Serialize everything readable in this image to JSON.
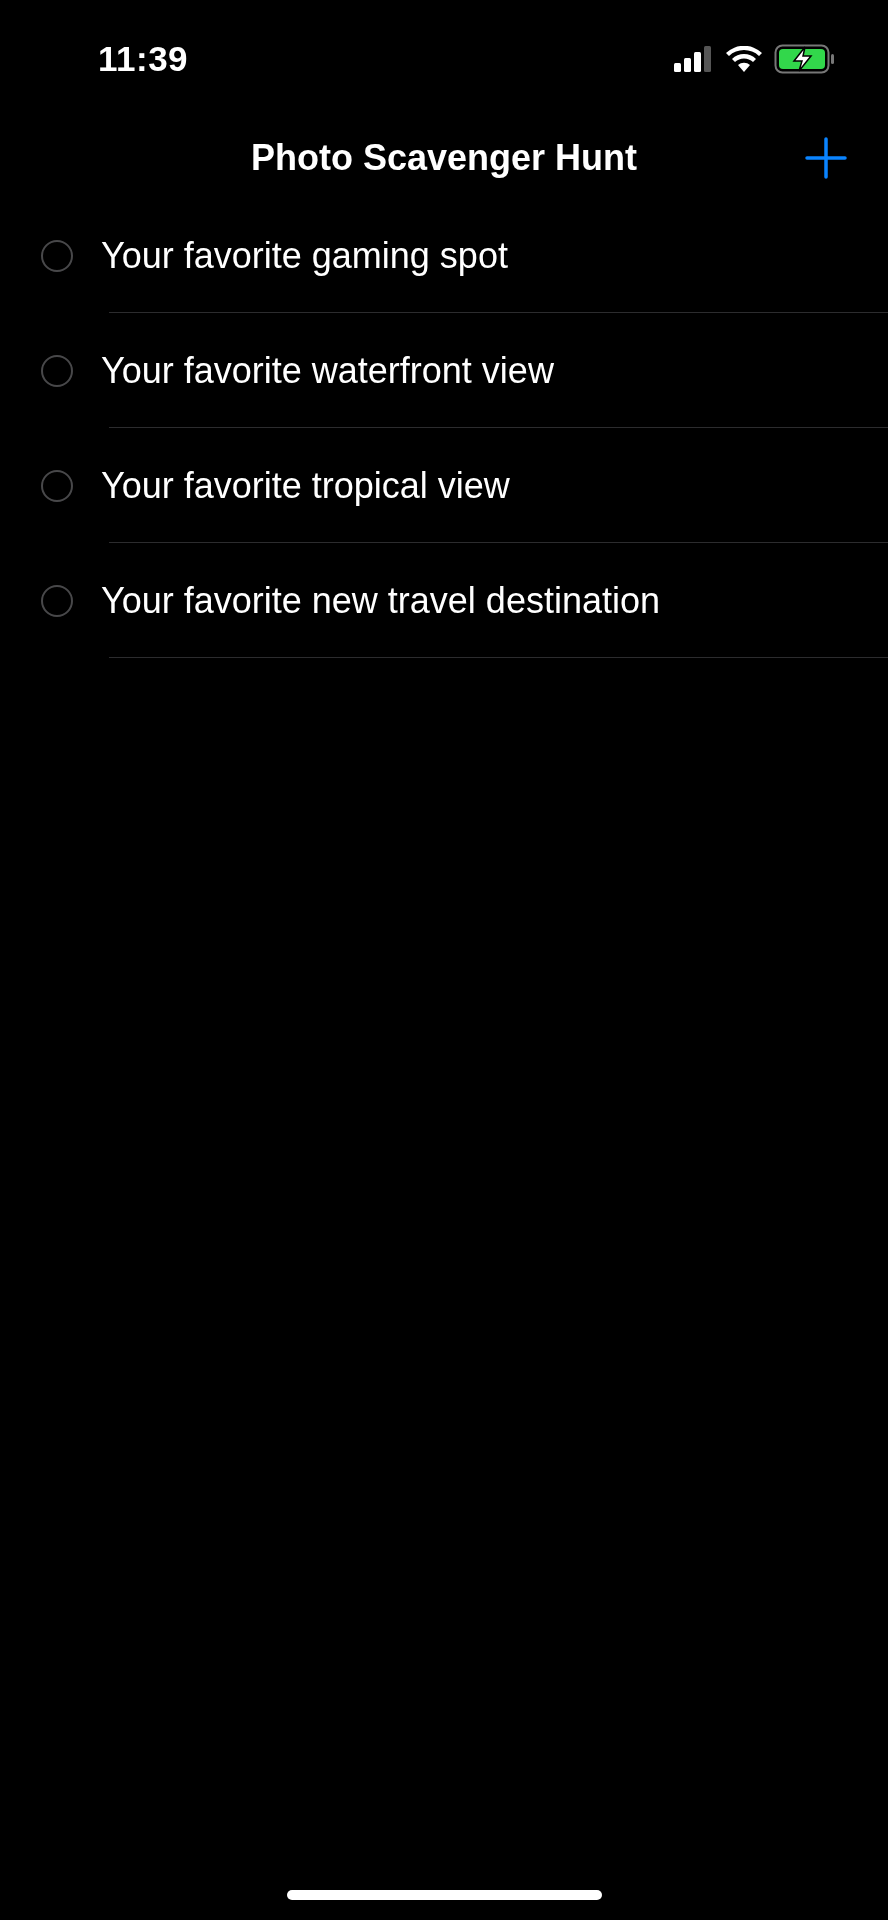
{
  "status_bar": {
    "time": "11:39",
    "battery_charging": true
  },
  "nav": {
    "title": "Photo Scavenger Hunt"
  },
  "tasks": [
    {
      "title": "Your favorite gaming spot",
      "completed": false
    },
    {
      "title": "Your favorite waterfront view",
      "completed": false
    },
    {
      "title": "Your favorite tropical view",
      "completed": false
    },
    {
      "title": "Your favorite new travel destination",
      "completed": false
    }
  ]
}
